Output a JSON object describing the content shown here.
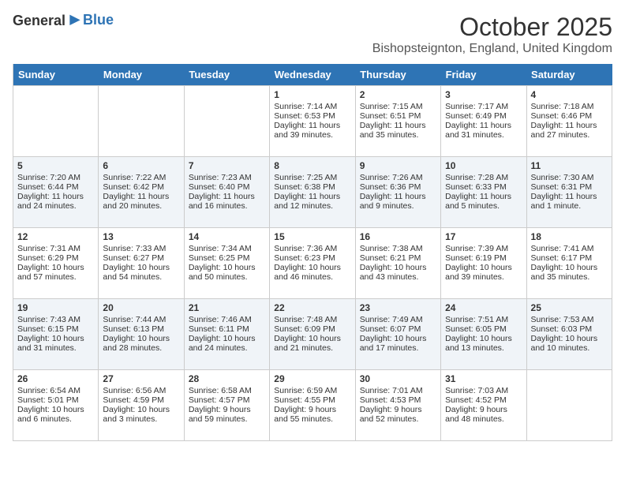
{
  "header": {
    "logo_general": "General",
    "logo_blue": "Blue",
    "month_title": "October 2025",
    "location": "Bishopsteignton, England, United Kingdom"
  },
  "days_of_week": [
    "Sunday",
    "Monday",
    "Tuesday",
    "Wednesday",
    "Thursday",
    "Friday",
    "Saturday"
  ],
  "weeks": [
    [
      {
        "day": "",
        "info": ""
      },
      {
        "day": "",
        "info": ""
      },
      {
        "day": "",
        "info": ""
      },
      {
        "day": "1",
        "info": "Sunrise: 7:14 AM\nSunset: 6:53 PM\nDaylight: 11 hours and 39 minutes."
      },
      {
        "day": "2",
        "info": "Sunrise: 7:15 AM\nSunset: 6:51 PM\nDaylight: 11 hours and 35 minutes."
      },
      {
        "day": "3",
        "info": "Sunrise: 7:17 AM\nSunset: 6:49 PM\nDaylight: 11 hours and 31 minutes."
      },
      {
        "day": "4",
        "info": "Sunrise: 7:18 AM\nSunset: 6:46 PM\nDaylight: 11 hours and 27 minutes."
      }
    ],
    [
      {
        "day": "5",
        "info": "Sunrise: 7:20 AM\nSunset: 6:44 PM\nDaylight: 11 hours and 24 minutes."
      },
      {
        "day": "6",
        "info": "Sunrise: 7:22 AM\nSunset: 6:42 PM\nDaylight: 11 hours and 20 minutes."
      },
      {
        "day": "7",
        "info": "Sunrise: 7:23 AM\nSunset: 6:40 PM\nDaylight: 11 hours and 16 minutes."
      },
      {
        "day": "8",
        "info": "Sunrise: 7:25 AM\nSunset: 6:38 PM\nDaylight: 11 hours and 12 minutes."
      },
      {
        "day": "9",
        "info": "Sunrise: 7:26 AM\nSunset: 6:36 PM\nDaylight: 11 hours and 9 minutes."
      },
      {
        "day": "10",
        "info": "Sunrise: 7:28 AM\nSunset: 6:33 PM\nDaylight: 11 hours and 5 minutes."
      },
      {
        "day": "11",
        "info": "Sunrise: 7:30 AM\nSunset: 6:31 PM\nDaylight: 11 hours and 1 minute."
      }
    ],
    [
      {
        "day": "12",
        "info": "Sunrise: 7:31 AM\nSunset: 6:29 PM\nDaylight: 10 hours and 57 minutes."
      },
      {
        "day": "13",
        "info": "Sunrise: 7:33 AM\nSunset: 6:27 PM\nDaylight: 10 hours and 54 minutes."
      },
      {
        "day": "14",
        "info": "Sunrise: 7:34 AM\nSunset: 6:25 PM\nDaylight: 10 hours and 50 minutes."
      },
      {
        "day": "15",
        "info": "Sunrise: 7:36 AM\nSunset: 6:23 PM\nDaylight: 10 hours and 46 minutes."
      },
      {
        "day": "16",
        "info": "Sunrise: 7:38 AM\nSunset: 6:21 PM\nDaylight: 10 hours and 43 minutes."
      },
      {
        "day": "17",
        "info": "Sunrise: 7:39 AM\nSunset: 6:19 PM\nDaylight: 10 hours and 39 minutes."
      },
      {
        "day": "18",
        "info": "Sunrise: 7:41 AM\nSunset: 6:17 PM\nDaylight: 10 hours and 35 minutes."
      }
    ],
    [
      {
        "day": "19",
        "info": "Sunrise: 7:43 AM\nSunset: 6:15 PM\nDaylight: 10 hours and 31 minutes."
      },
      {
        "day": "20",
        "info": "Sunrise: 7:44 AM\nSunset: 6:13 PM\nDaylight: 10 hours and 28 minutes."
      },
      {
        "day": "21",
        "info": "Sunrise: 7:46 AM\nSunset: 6:11 PM\nDaylight: 10 hours and 24 minutes."
      },
      {
        "day": "22",
        "info": "Sunrise: 7:48 AM\nSunset: 6:09 PM\nDaylight: 10 hours and 21 minutes."
      },
      {
        "day": "23",
        "info": "Sunrise: 7:49 AM\nSunset: 6:07 PM\nDaylight: 10 hours and 17 minutes."
      },
      {
        "day": "24",
        "info": "Sunrise: 7:51 AM\nSunset: 6:05 PM\nDaylight: 10 hours and 13 minutes."
      },
      {
        "day": "25",
        "info": "Sunrise: 7:53 AM\nSunset: 6:03 PM\nDaylight: 10 hours and 10 minutes."
      }
    ],
    [
      {
        "day": "26",
        "info": "Sunrise: 6:54 AM\nSunset: 5:01 PM\nDaylight: 10 hours and 6 minutes."
      },
      {
        "day": "27",
        "info": "Sunrise: 6:56 AM\nSunset: 4:59 PM\nDaylight: 10 hours and 3 minutes."
      },
      {
        "day": "28",
        "info": "Sunrise: 6:58 AM\nSunset: 4:57 PM\nDaylight: 9 hours and 59 minutes."
      },
      {
        "day": "29",
        "info": "Sunrise: 6:59 AM\nSunset: 4:55 PM\nDaylight: 9 hours and 55 minutes."
      },
      {
        "day": "30",
        "info": "Sunrise: 7:01 AM\nSunset: 4:53 PM\nDaylight: 9 hours and 52 minutes."
      },
      {
        "day": "31",
        "info": "Sunrise: 7:03 AM\nSunset: 4:52 PM\nDaylight: 9 hours and 48 minutes."
      },
      {
        "day": "",
        "info": ""
      }
    ]
  ]
}
